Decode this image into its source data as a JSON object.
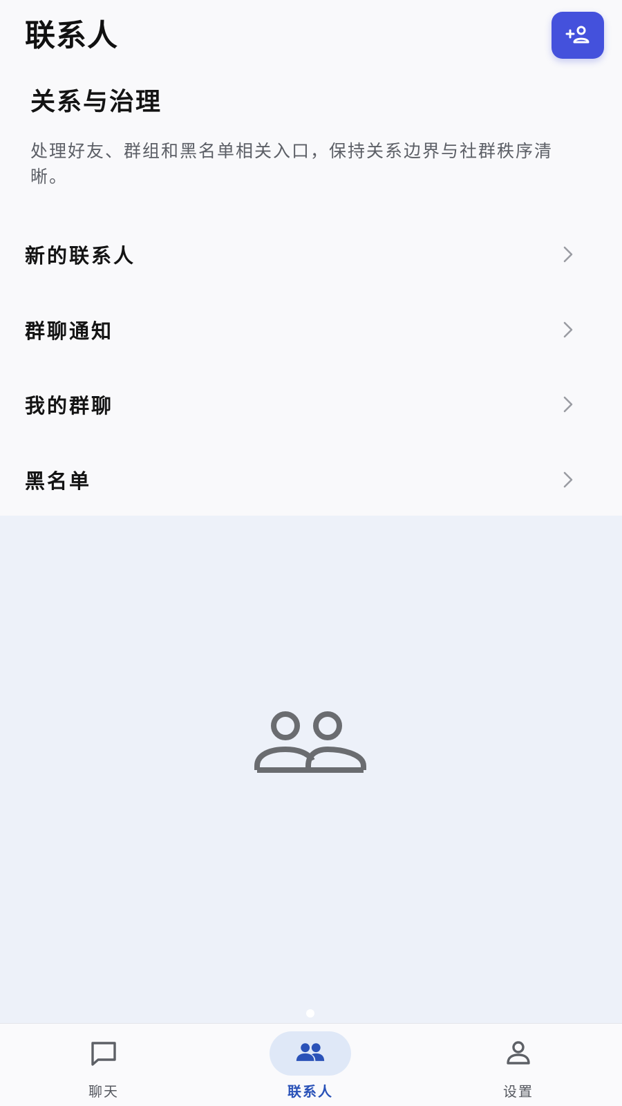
{
  "header": {
    "title": "联系人",
    "add_contact_icon": "add-person-icon"
  },
  "section": {
    "title": "关系与治理",
    "description": "处理好友、群组和黑名单相关入口，保持关系边界与社群秩序清晰。"
  },
  "menu": {
    "items": [
      {
        "label": "新的联系人",
        "icon": "chevron-right-icon"
      },
      {
        "label": "群聊通知",
        "icon": "chevron-right-icon"
      },
      {
        "label": "我的群聊",
        "icon": "chevron-right-icon"
      },
      {
        "label": "黑名单",
        "icon": "chevron-right-icon"
      }
    ]
  },
  "empty_state": {
    "illustration": "people-icon",
    "page_indicator_count": 1
  },
  "bottom_nav": {
    "active_index": 1,
    "items": [
      {
        "label": "聊天",
        "icon": "chat-bubble-icon"
      },
      {
        "label": "联系人",
        "icon": "people-icon"
      },
      {
        "label": "设置",
        "icon": "person-icon"
      }
    ]
  },
  "colors": {
    "accent": "#4451dc",
    "active_nav": "#2a52b8",
    "active_pill": "#dfe8f7",
    "empty_background": "#edf1f9",
    "illustration": "#6a6c70"
  }
}
